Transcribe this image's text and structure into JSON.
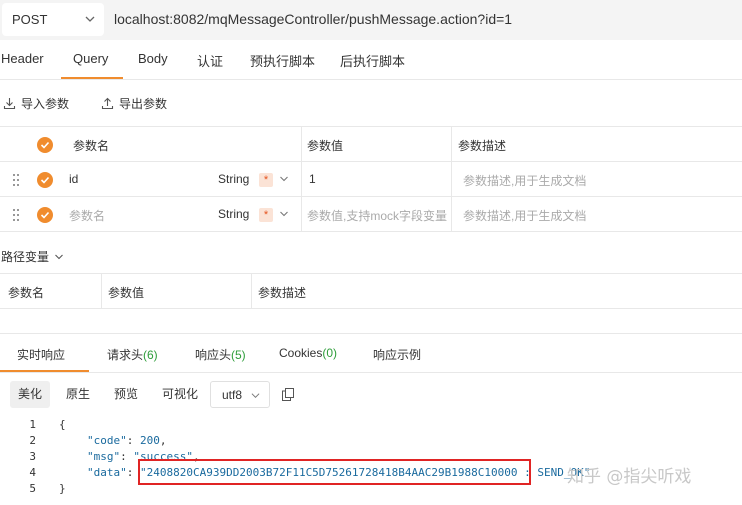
{
  "request": {
    "method": "POST",
    "url": "localhost:8082/mqMessageController/pushMessage.action?id=1"
  },
  "tabs": [
    "Header",
    "Query",
    "Body",
    "认证",
    "预执行脚本",
    "后执行脚本"
  ],
  "active_tab": "Query",
  "params_actions": {
    "import": "导入参数",
    "export": "导出参数"
  },
  "params_table": {
    "headers": {
      "name": "参数名",
      "value": "参数值",
      "desc": "参数描述"
    },
    "rows": [
      {
        "name": "id",
        "type": "String",
        "required": "*",
        "value": "1",
        "desc_placeholder": "参数描述,用于生成文档"
      },
      {
        "name_placeholder": "参数名",
        "type": "String",
        "required": "*",
        "value_placeholder": "参数值,支持mock字段变量",
        "desc_placeholder": "参数描述,用于生成文档"
      }
    ]
  },
  "path_vars": {
    "label": "路径变量",
    "headers": {
      "name": "参数名",
      "value": "参数值",
      "desc": "参数描述"
    }
  },
  "response_tabs": [
    {
      "label": "实时响应",
      "count": ""
    },
    {
      "label": "请求头",
      "count": "(6)"
    },
    {
      "label": "响应头",
      "count": "(5)"
    },
    {
      "label": "Cookies",
      "count": "(0)"
    },
    {
      "label": "响应示例",
      "count": ""
    }
  ],
  "view_buttons": [
    "美化",
    "原生",
    "预览",
    "可视化"
  ],
  "encoding": "utf8",
  "response_body": {
    "line_numbers": [
      "1",
      "2",
      "3",
      "4",
      "5"
    ],
    "open_brace": "{",
    "close_brace": "}",
    "code_key": "\"code\"",
    "code_value": "200",
    "msg_key": "\"msg\"",
    "msg_value": "\"success\"",
    "data_key": "\"data\"",
    "data_value": "\"2408820CA939DD2003B72F11C5D75261728418B4AAC29B1988C10000 : SEND_OK\""
  },
  "watermark": "知乎 @指尖听戏",
  "colors": {
    "accent": "#f08c2e",
    "highlight_box": "#e02424",
    "count": "#2e9d3a"
  }
}
